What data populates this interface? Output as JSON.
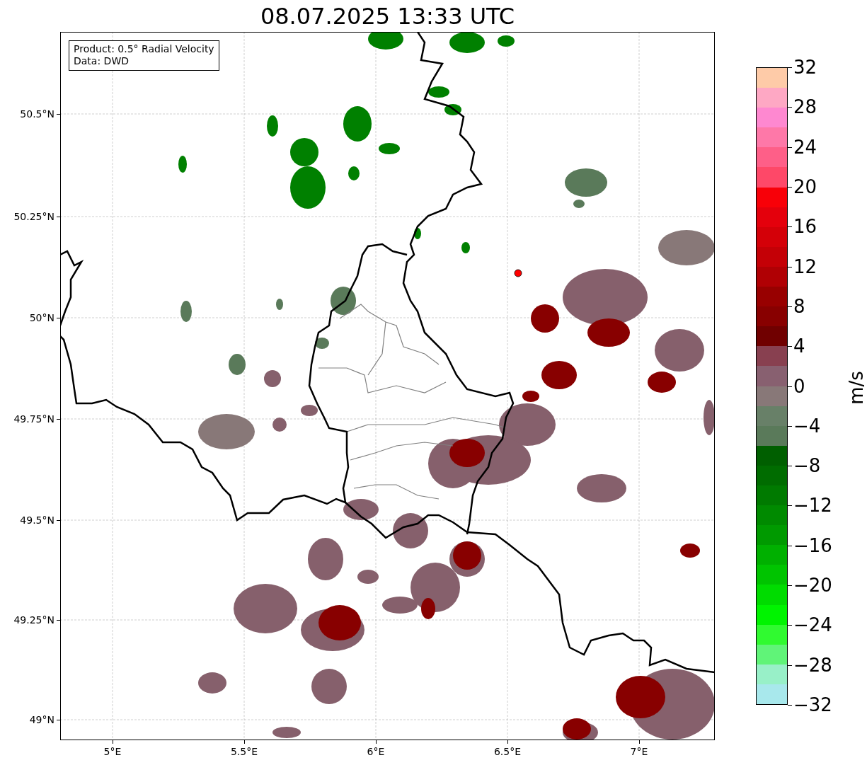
{
  "title": "08.07.2025 13:33 UTC",
  "info_box": {
    "lines": [
      "Product: 0.5° Radial Velocity",
      "Data: DWD"
    ]
  },
  "map": {
    "yticks": [
      "50.5°N",
      "50.25°N",
      "50°N",
      "49.75°N",
      "49.5°N",
      "49.25°N",
      "49°N"
    ],
    "xticks": [
      "5°E",
      "5.5°E",
      "6°E",
      "6.5°E",
      "7°E"
    ]
  },
  "colorbar": {
    "label": "m/s",
    "ticks": [
      "32",
      "28",
      "24",
      "20",
      "16",
      "12",
      "8",
      "4",
      "0",
      "−4",
      "−8",
      "−12",
      "−16",
      "−20",
      "−24",
      "−28",
      "−32"
    ],
    "bands": [
      {
        "color": "#fecba8"
      },
      {
        "color": "#fea8c4"
      },
      {
        "color": "#fe88d0"
      },
      {
        "color": "#fe78a8"
      },
      {
        "color": "#fe5f88"
      },
      {
        "color": "#fe4868"
      },
      {
        "color": "#f80008"
      },
      {
        "color": "#e4000c"
      },
      {
        "color": "#d40008"
      },
      {
        "color": "#c40006"
      },
      {
        "color": "#b00004"
      },
      {
        "color": "#980000"
      },
      {
        "color": "#880000"
      },
      {
        "color": "#700000"
      },
      {
        "color": "#884050"
      },
      {
        "color": "#886070"
      },
      {
        "color": "#887878"
      },
      {
        "color": "#688068"
      },
      {
        "color": "#5a7a5a"
      },
      {
        "color": "#005f00"
      },
      {
        "color": "#006c00"
      },
      {
        "color": "#007a00"
      },
      {
        "color": "#008a00"
      },
      {
        "color": "#009a00"
      },
      {
        "color": "#00b000"
      },
      {
        "color": "#00c400"
      },
      {
        "color": "#00dc00"
      },
      {
        "color": "#00f400"
      },
      {
        "color": "#30fa30"
      },
      {
        "color": "#60f478"
      },
      {
        "color": "#98f0c8"
      },
      {
        "color": "#a8e8ec"
      }
    ]
  }
}
